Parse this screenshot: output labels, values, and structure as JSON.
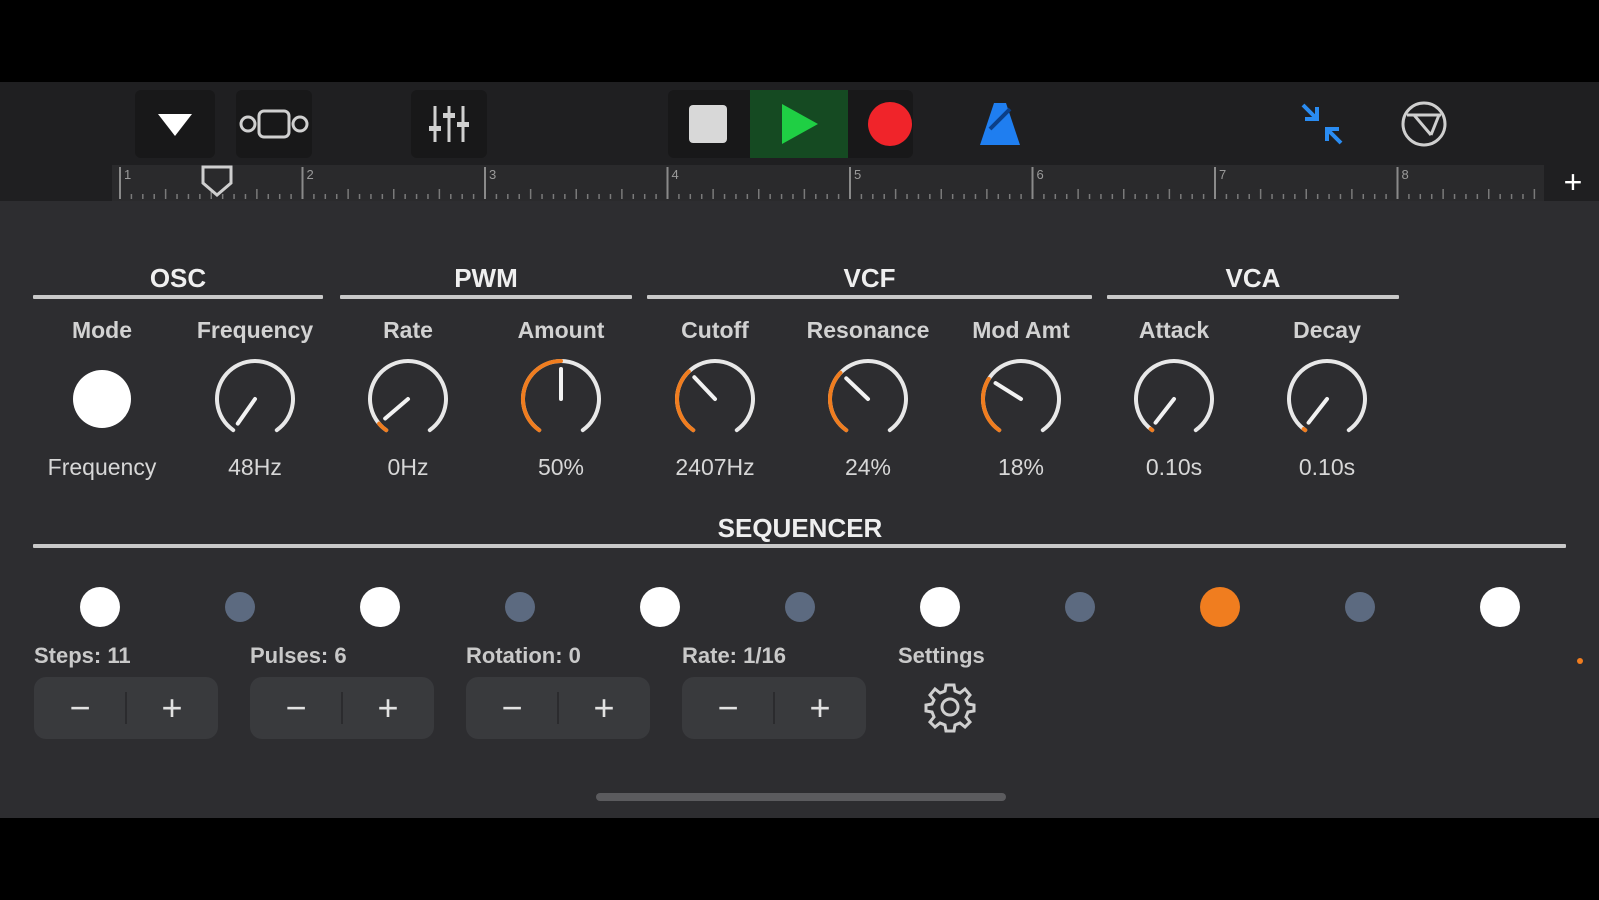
{
  "toolbar": {
    "dropdown_icon": "triangle-down-icon",
    "loop_icon": "loop-region-icon",
    "mixer_icon": "sliders-icon",
    "stop_icon": "stop-icon",
    "play_icon": "play-icon",
    "record_icon": "record-icon",
    "metronome_icon": "metronome-icon",
    "collapse_icon": "collapse-arrows-icon",
    "tempo_icon": "steering-wheel-icon",
    "colors": {
      "play": "#1fcf44",
      "record": "#f0242a",
      "metronome": "#1f7ef0",
      "collapse": "#2a8cf2"
    }
  },
  "ruler": {
    "bars": [
      "1",
      "2",
      "3",
      "4",
      "5",
      "6",
      "7",
      "8"
    ],
    "add_label": "+"
  },
  "sections": [
    {
      "title": "OSC"
    },
    {
      "title": "PWM"
    },
    {
      "title": "VCF"
    },
    {
      "title": "VCA"
    }
  ],
  "params": [
    {
      "label": "Mode",
      "value": "Frequency",
      "type": "toggle"
    },
    {
      "label": "Frequency",
      "value": "48Hz",
      "level": 0.0
    },
    {
      "label": "Rate",
      "value": "0Hz",
      "level": 0.05
    },
    {
      "label": "Amount",
      "value": "50%",
      "level": 0.5
    },
    {
      "label": "Cutoff",
      "value": "2407Hz",
      "level": 0.35
    },
    {
      "label": "Resonance",
      "value": "24%",
      "level": 0.34
    },
    {
      "label": "Mod Amt",
      "value": "18%",
      "level": 0.3
    },
    {
      "label": "Attack",
      "value": "0.10s",
      "level": 0.01
    },
    {
      "label": "Decay",
      "value": "0.10s",
      "level": 0.01
    }
  ],
  "sequencer": {
    "title": "SEQUENCER",
    "steps_state": [
      "on",
      "off",
      "on",
      "off",
      "on",
      "off",
      "on",
      "off",
      "active",
      "off",
      "on"
    ],
    "colors": {
      "on": "#ffffff",
      "off": "#5c6a80",
      "active": "#f07d1f"
    },
    "controls": [
      {
        "label": "Steps: 11",
        "minus": "−",
        "plus": "+"
      },
      {
        "label": "Pulses: 6",
        "minus": "−",
        "plus": "+"
      },
      {
        "label": "Rotation: 0",
        "minus": "−",
        "plus": "+"
      },
      {
        "label": "Rate: 1/16",
        "minus": "−",
        "plus": "+"
      }
    ],
    "settings_label": "Settings",
    "settings_icon": "gear-icon"
  },
  "accent": "#f07d1f"
}
